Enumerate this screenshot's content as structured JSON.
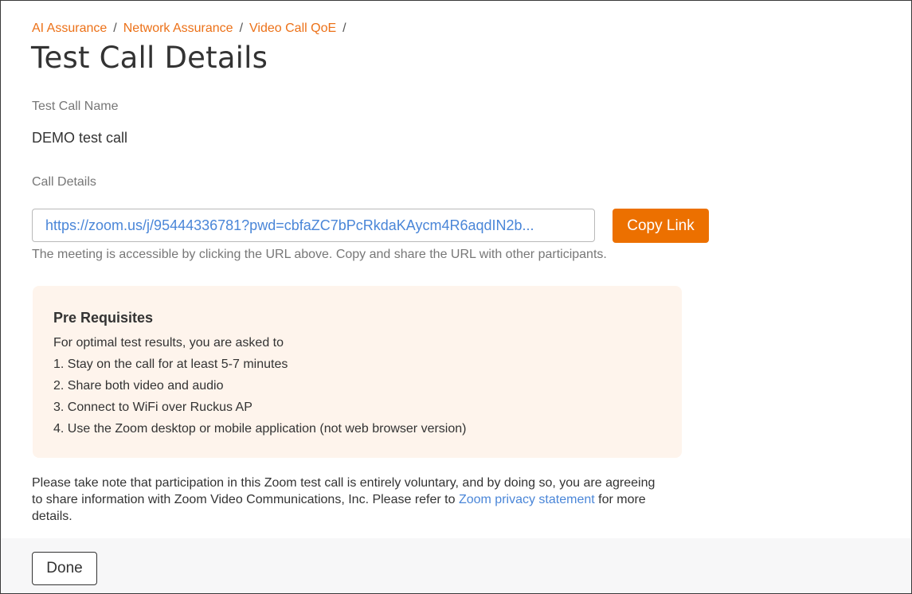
{
  "breadcrumb": {
    "items": [
      "AI Assurance",
      "Network Assurance",
      "Video Call QoE"
    ],
    "separator": "/"
  },
  "page_title": "Test Call Details",
  "test_call_name": {
    "label": "Test Call Name",
    "value": "DEMO test call"
  },
  "call_details": {
    "label": "Call Details",
    "url": "https://zoom.us/j/95444336781?pwd=cbfaZC7bPcRkdaKAycm4R6aqdIN2b...",
    "copy_label": "Copy Link",
    "helper": "The meeting is accessible by clicking the URL above. Copy and share the URL with other participants."
  },
  "prerequisites": {
    "title": "Pre Requisites",
    "intro": "For optimal test results, you are asked to",
    "items": [
      "1. Stay on the call for at least 5-7 minutes",
      "2. Share both video and audio",
      "3. Connect to WiFi over Ruckus AP",
      "4. Use the Zoom desktop or mobile application (not web browser version)"
    ]
  },
  "note": {
    "text_before": "Please take note that participation in this Zoom test call is entirely voluntary, and by doing so, you are agreeing to share information with Zoom Video Communications, Inc. Please refer to ",
    "link": "Zoom privacy statement",
    "text_after": " for more details."
  },
  "footer": {
    "done_label": "Done"
  },
  "colors": {
    "accent": "#ec7000",
    "link": "#4a86d8",
    "prereq_bg": "#fef4ec"
  }
}
